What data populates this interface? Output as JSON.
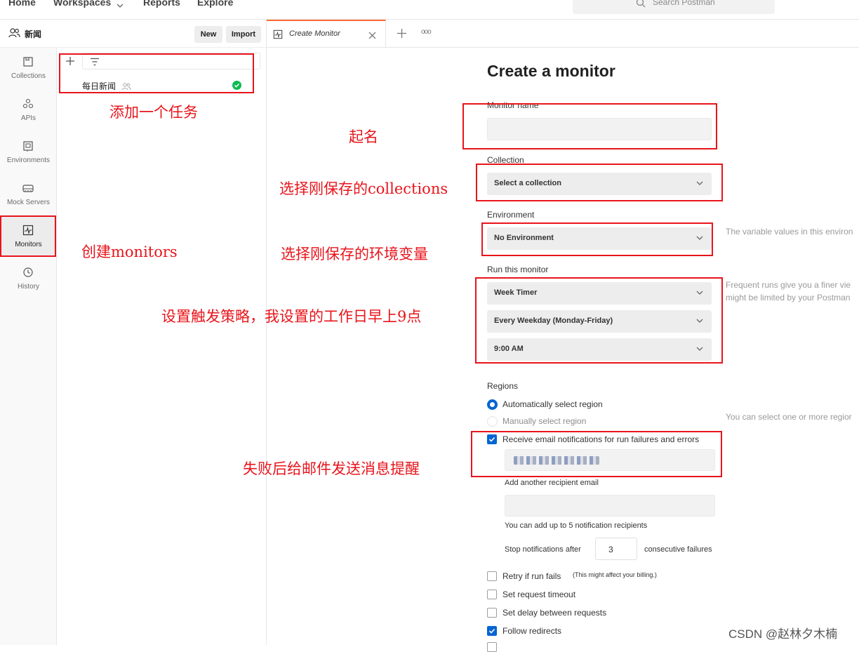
{
  "topnav": {
    "home": "Home",
    "workspaces": "Workspaces",
    "reports": "Reports",
    "explore": "Explore",
    "search_placeholder": "Search Postman"
  },
  "workspace": {
    "name": "新闻",
    "new_label": "New",
    "import_label": "Import"
  },
  "rail": [
    {
      "label": "Collections",
      "icon": "collections-icon"
    },
    {
      "label": "APIs",
      "icon": "apis-icon"
    },
    {
      "label": "Environments",
      "icon": "environments-icon"
    },
    {
      "label": "Mock Servers",
      "icon": "mock-servers-icon"
    },
    {
      "label": "Monitors",
      "icon": "monitors-icon",
      "active": true
    },
    {
      "label": "History",
      "icon": "history-icon"
    }
  ],
  "sidebar": {
    "monitor_item": "每日新闻"
  },
  "tab": {
    "label": "Create Monitor"
  },
  "form": {
    "title": "Create a monitor",
    "name_label": "Monitor name",
    "name_value": "",
    "collection_label": "Collection",
    "collection_value": "Select a collection",
    "environment_label": "Environment",
    "environment_value": "No Environment",
    "environment_hint": "The variable values in this environ",
    "run_label": "Run this monitor",
    "timer_value": "Week Timer",
    "days_value": "Every Weekday (Monday-Friday)",
    "time_value": "9:00 AM",
    "run_hint_1": "Frequent runs give you a finer vie",
    "run_hint_2": "might be limited by your Postman",
    "regions_label": "Regions",
    "region_auto": "Automatically select region",
    "region_manual": "Manually select region",
    "regions_hint": "You can select one or more regior",
    "email_notify": "Receive email notifications for run failures and errors",
    "add_recipient": "Add another recipient email",
    "recipient_hint": "You can add up to 5 notification recipients",
    "stop_after": "Stop notifications after",
    "stop_count": "3",
    "consecutive": "consecutive failures",
    "retry": "Retry if run fails",
    "retry_note": "(This might affect your billing.)",
    "timeout": "Set request timeout",
    "delay": "Set delay between requests",
    "follow_redirects": "Follow redirects"
  },
  "annotations": {
    "add_task": "添加一个任务",
    "name_it": "起名",
    "choose_collection": "选择刚保存的collections",
    "create_monitors": "创建monitors",
    "choose_env": "选择刚保存的环境变量",
    "trigger": "设置触发策略，我设置的工作日早上9点",
    "notify": "失败后给邮件发送消息提醒"
  },
  "watermark": "CSDN @赵林夕木楠",
  "colors": {
    "accent": "#ff6c37",
    "blue": "#0265d2",
    "annotation_red": "#e8141b",
    "success_green": "#0cbb52"
  }
}
